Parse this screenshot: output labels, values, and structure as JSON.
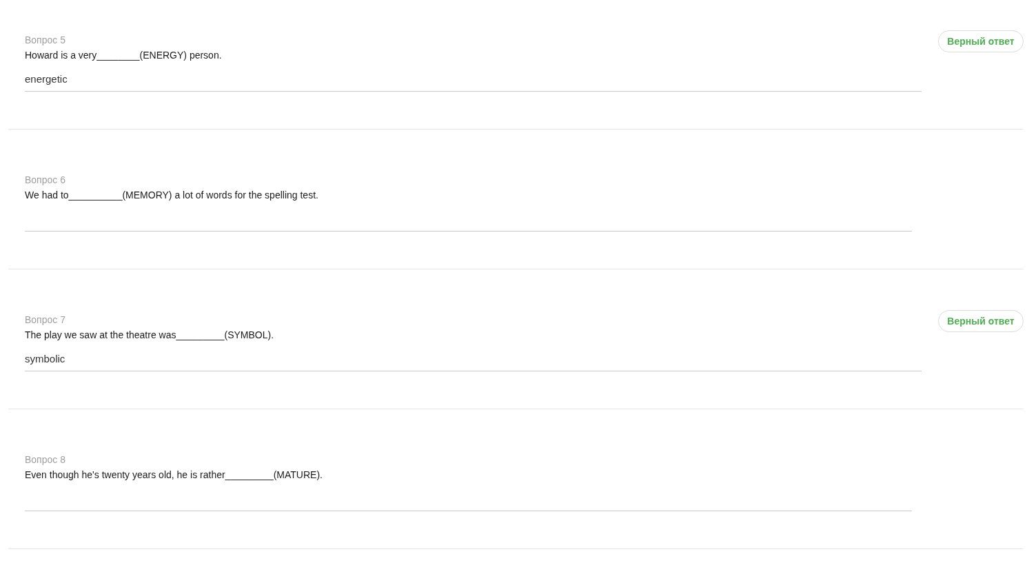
{
  "questions": [
    {
      "label": "Вопрос 5",
      "text": "Howard is a very________(ENERGY) person.",
      "answer": "energetic",
      "verdict": "Верный ответ"
    },
    {
      "label": "Вопрос 6",
      "text": "We had to__________(MEMORY) a lot of words for the spelling test."
    },
    {
      "label": "Вопрос 7",
      "text": "The play we saw at the theatre was_________(SYMBOL).",
      "answer": "symbolic",
      "verdict": "Верный ответ"
    },
    {
      "label": "Вопрос 8",
      "text": "Even though he's twenty years old, he is rather_________(MATURE)."
    }
  ]
}
